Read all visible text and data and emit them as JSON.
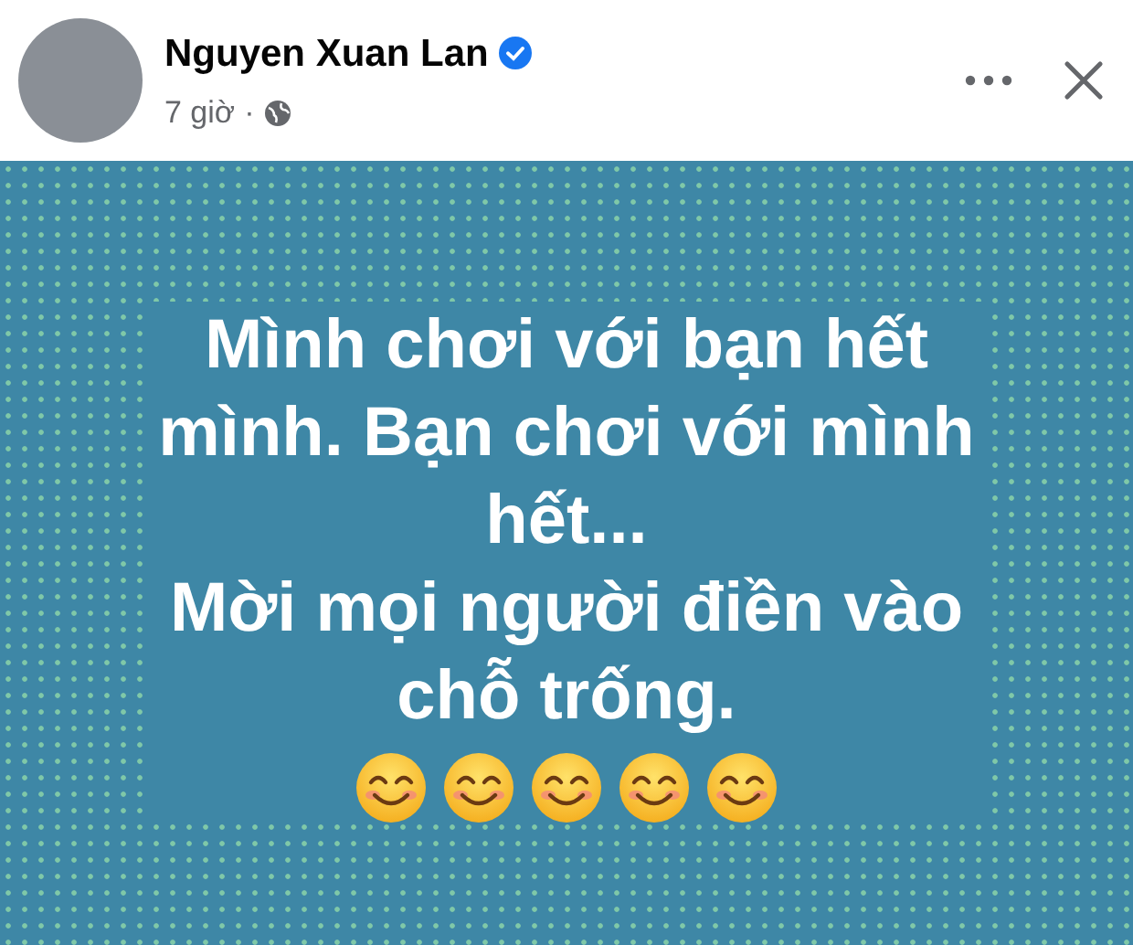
{
  "post": {
    "author": "Nguyen Xuan Lan",
    "verified": true,
    "time": "7 giờ",
    "separator": "·",
    "body": [
      "Mình chơi với bạn hết",
      "mình. Bạn chơi với mình",
      "hết...",
      "Mời mọi người điền vào",
      "chỗ trống."
    ],
    "emojis": [
      {
        "kind": "smile"
      },
      {
        "kind": "smile"
      },
      {
        "kind": "smile"
      },
      {
        "kind": "smile"
      },
      {
        "kind": "smile"
      }
    ]
  }
}
